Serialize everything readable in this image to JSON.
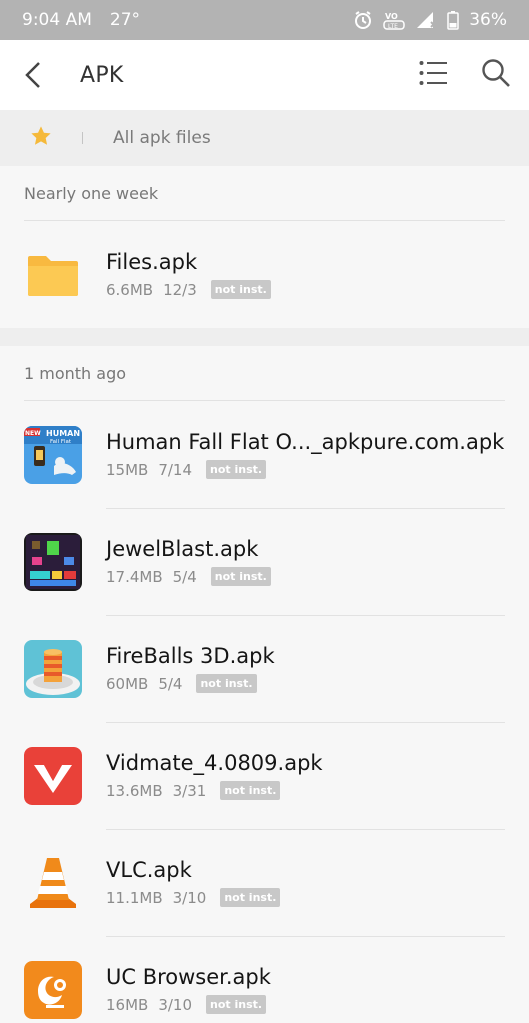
{
  "status_bar": {
    "time": "9:04 AM",
    "temperature": "27°",
    "battery": "36%",
    "icons": [
      "alarm-icon",
      "volte-icon",
      "signal-icon",
      "battery-icon"
    ]
  },
  "app_bar": {
    "title": "APK",
    "back_icon": "chevron-left-icon",
    "actions": [
      "list-view-icon",
      "search-icon"
    ]
  },
  "filter_bar": {
    "star_icon": "star-icon",
    "label": "All apk files",
    "accent": "#f5b93a"
  },
  "sections": [
    {
      "header": "Nearly one week",
      "items": [
        {
          "name": "Files.apk",
          "size": "6.6MB",
          "date": "12/3",
          "status": "not inst.",
          "icon": "folder-icon"
        }
      ]
    },
    {
      "header": "1 month ago",
      "items": [
        {
          "name": "Human Fall Flat O..._apkpure.com.apk",
          "size": "15MB",
          "date": "7/14",
          "status": "not inst.",
          "icon": "human-fall-flat-app-icon"
        },
        {
          "name": "JewelBlast.apk",
          "size": "17.4MB",
          "date": "5/4",
          "status": "not inst.",
          "icon": "jewel-blast-app-icon"
        },
        {
          "name": "FireBalls 3D.apk",
          "size": "60MB",
          "date": "5/4",
          "status": "not inst.",
          "icon": "fireballs-app-icon"
        },
        {
          "name": "Vidmate_4.0809.apk",
          "size": "13.6MB",
          "date": "3/31",
          "status": "not inst.",
          "icon": "vidmate-app-icon"
        },
        {
          "name": "VLC.apk",
          "size": "11.1MB",
          "date": "3/10",
          "status": "not inst.",
          "icon": "vlc-app-icon"
        },
        {
          "name": "UC Browser.apk",
          "size": "16MB",
          "date": "3/10",
          "status": "not inst.",
          "icon": "uc-browser-app-icon"
        }
      ]
    }
  ],
  "human_fall_flat_icon_text": [
    "NEW",
    "HUMAN",
    "Fall Flat"
  ]
}
